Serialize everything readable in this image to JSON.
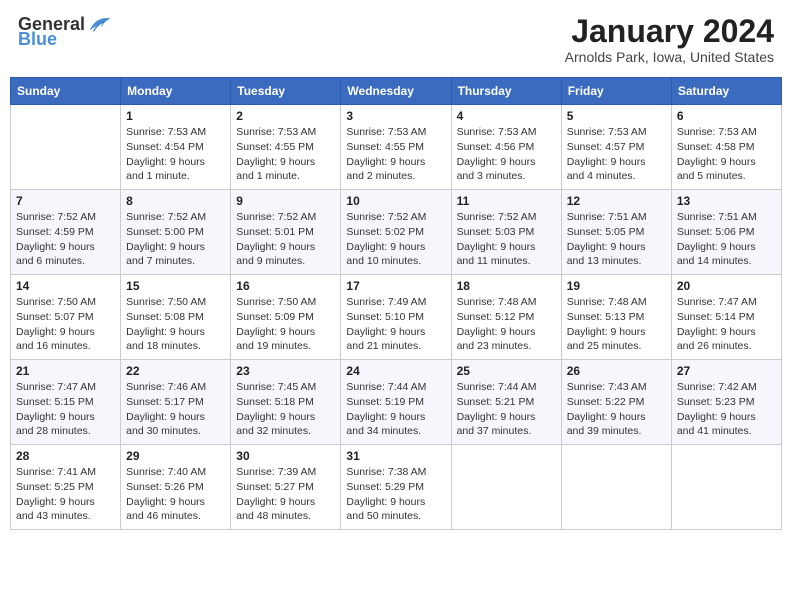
{
  "header": {
    "logo_general": "General",
    "logo_blue": "Blue",
    "title": "January 2024",
    "subtitle": "Arnolds Park, Iowa, United States"
  },
  "calendar": {
    "days_of_week": [
      "Sunday",
      "Monday",
      "Tuesday",
      "Wednesday",
      "Thursday",
      "Friday",
      "Saturday"
    ],
    "weeks": [
      [
        {
          "day": "",
          "info": ""
        },
        {
          "day": "1",
          "info": "Sunrise: 7:53 AM\nSunset: 4:54 PM\nDaylight: 9 hours\nand 1 minute."
        },
        {
          "day": "2",
          "info": "Sunrise: 7:53 AM\nSunset: 4:55 PM\nDaylight: 9 hours\nand 1 minute."
        },
        {
          "day": "3",
          "info": "Sunrise: 7:53 AM\nSunset: 4:55 PM\nDaylight: 9 hours\nand 2 minutes."
        },
        {
          "day": "4",
          "info": "Sunrise: 7:53 AM\nSunset: 4:56 PM\nDaylight: 9 hours\nand 3 minutes."
        },
        {
          "day": "5",
          "info": "Sunrise: 7:53 AM\nSunset: 4:57 PM\nDaylight: 9 hours\nand 4 minutes."
        },
        {
          "day": "6",
          "info": "Sunrise: 7:53 AM\nSunset: 4:58 PM\nDaylight: 9 hours\nand 5 minutes."
        }
      ],
      [
        {
          "day": "7",
          "info": "Sunrise: 7:52 AM\nSunset: 4:59 PM\nDaylight: 9 hours\nand 6 minutes."
        },
        {
          "day": "8",
          "info": "Sunrise: 7:52 AM\nSunset: 5:00 PM\nDaylight: 9 hours\nand 7 minutes."
        },
        {
          "day": "9",
          "info": "Sunrise: 7:52 AM\nSunset: 5:01 PM\nDaylight: 9 hours\nand 9 minutes."
        },
        {
          "day": "10",
          "info": "Sunrise: 7:52 AM\nSunset: 5:02 PM\nDaylight: 9 hours\nand 10 minutes."
        },
        {
          "day": "11",
          "info": "Sunrise: 7:52 AM\nSunset: 5:03 PM\nDaylight: 9 hours\nand 11 minutes."
        },
        {
          "day": "12",
          "info": "Sunrise: 7:51 AM\nSunset: 5:05 PM\nDaylight: 9 hours\nand 13 minutes."
        },
        {
          "day": "13",
          "info": "Sunrise: 7:51 AM\nSunset: 5:06 PM\nDaylight: 9 hours\nand 14 minutes."
        }
      ],
      [
        {
          "day": "14",
          "info": "Sunrise: 7:50 AM\nSunset: 5:07 PM\nDaylight: 9 hours\nand 16 minutes."
        },
        {
          "day": "15",
          "info": "Sunrise: 7:50 AM\nSunset: 5:08 PM\nDaylight: 9 hours\nand 18 minutes."
        },
        {
          "day": "16",
          "info": "Sunrise: 7:50 AM\nSunset: 5:09 PM\nDaylight: 9 hours\nand 19 minutes."
        },
        {
          "day": "17",
          "info": "Sunrise: 7:49 AM\nSunset: 5:10 PM\nDaylight: 9 hours\nand 21 minutes."
        },
        {
          "day": "18",
          "info": "Sunrise: 7:48 AM\nSunset: 5:12 PM\nDaylight: 9 hours\nand 23 minutes."
        },
        {
          "day": "19",
          "info": "Sunrise: 7:48 AM\nSunset: 5:13 PM\nDaylight: 9 hours\nand 25 minutes."
        },
        {
          "day": "20",
          "info": "Sunrise: 7:47 AM\nSunset: 5:14 PM\nDaylight: 9 hours\nand 26 minutes."
        }
      ],
      [
        {
          "day": "21",
          "info": "Sunrise: 7:47 AM\nSunset: 5:15 PM\nDaylight: 9 hours\nand 28 minutes."
        },
        {
          "day": "22",
          "info": "Sunrise: 7:46 AM\nSunset: 5:17 PM\nDaylight: 9 hours\nand 30 minutes."
        },
        {
          "day": "23",
          "info": "Sunrise: 7:45 AM\nSunset: 5:18 PM\nDaylight: 9 hours\nand 32 minutes."
        },
        {
          "day": "24",
          "info": "Sunrise: 7:44 AM\nSunset: 5:19 PM\nDaylight: 9 hours\nand 34 minutes."
        },
        {
          "day": "25",
          "info": "Sunrise: 7:44 AM\nSunset: 5:21 PM\nDaylight: 9 hours\nand 37 minutes."
        },
        {
          "day": "26",
          "info": "Sunrise: 7:43 AM\nSunset: 5:22 PM\nDaylight: 9 hours\nand 39 minutes."
        },
        {
          "day": "27",
          "info": "Sunrise: 7:42 AM\nSunset: 5:23 PM\nDaylight: 9 hours\nand 41 minutes."
        }
      ],
      [
        {
          "day": "28",
          "info": "Sunrise: 7:41 AM\nSunset: 5:25 PM\nDaylight: 9 hours\nand 43 minutes."
        },
        {
          "day": "29",
          "info": "Sunrise: 7:40 AM\nSunset: 5:26 PM\nDaylight: 9 hours\nand 46 minutes."
        },
        {
          "day": "30",
          "info": "Sunrise: 7:39 AM\nSunset: 5:27 PM\nDaylight: 9 hours\nand 48 minutes."
        },
        {
          "day": "31",
          "info": "Sunrise: 7:38 AM\nSunset: 5:29 PM\nDaylight: 9 hours\nand 50 minutes."
        },
        {
          "day": "",
          "info": ""
        },
        {
          "day": "",
          "info": ""
        },
        {
          "day": "",
          "info": ""
        }
      ]
    ]
  }
}
